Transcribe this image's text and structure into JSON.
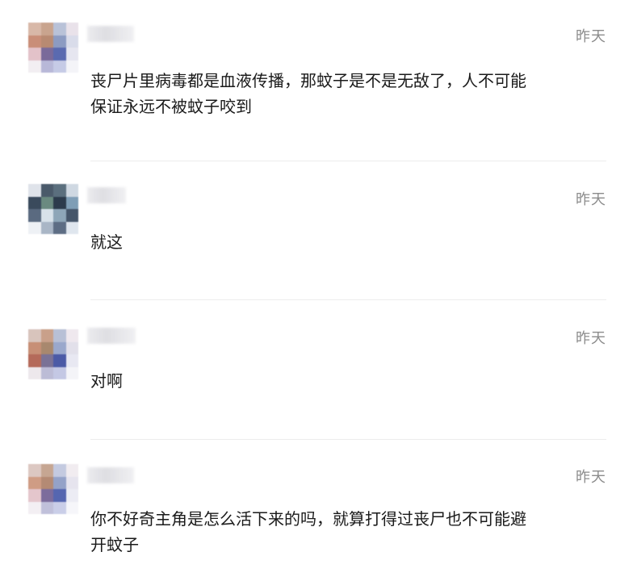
{
  "comments": [
    {
      "time": "昨天",
      "text": "丧尸片里病毒都是血液传播，那蚊子是不是无敌了，人不可能保证永远不被蚊子咬到"
    },
    {
      "time": "昨天",
      "text": "就这"
    },
    {
      "time": "昨天",
      "text": "对啊"
    },
    {
      "time": "昨天",
      "text": "你不好奇主角是怎么活下来的吗，就算打得过丧尸也不可能避开蚊子"
    }
  ]
}
